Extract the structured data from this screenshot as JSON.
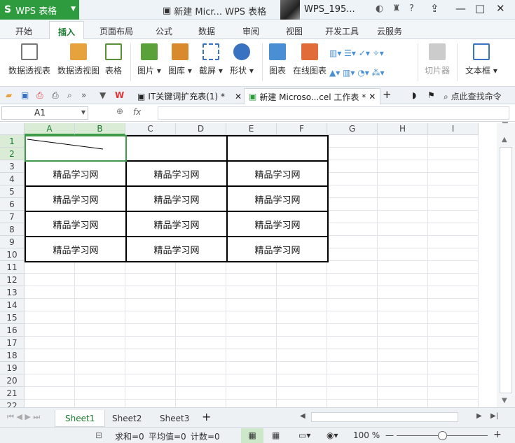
{
  "app": {
    "name": "WPS 表格",
    "logo": "S"
  },
  "title": {
    "doc": "新建 Micr... WPS 表格",
    "user": "WPS_195..."
  },
  "menu": [
    "开始",
    "插入",
    "页面布局",
    "公式",
    "数据",
    "审阅",
    "视图",
    "开发工具",
    "云服务"
  ],
  "ribbon": [
    "数据透视表",
    "数据透视图",
    "表格",
    "图片",
    "图库",
    "截屏",
    "形状",
    "图表",
    "在线图表",
    "切片器",
    "文本框"
  ],
  "tabs": {
    "tab1": "IT关键词扩充表(1) *",
    "tab2": "新建 Microso...cel 工作表 *",
    "find": "点此查找命令"
  },
  "formula": {
    "cell": "A1",
    "fx": "fx"
  },
  "columns": [
    "A",
    "B",
    "C",
    "D",
    "E",
    "F",
    "G",
    "H",
    "I"
  ],
  "rows": [
    "1",
    "2",
    "3",
    "4",
    "5",
    "6",
    "7",
    "8",
    "9",
    "10",
    "11",
    "12",
    "13",
    "14",
    "15",
    "16",
    "17",
    "18",
    "19",
    "20",
    "21",
    "22"
  ],
  "cell_text": "精品学习网",
  "sheets": [
    "Sheet1",
    "Sheet2",
    "Sheet3"
  ],
  "status": {
    "sum": "求和=0",
    "avg": "平均值=0",
    "count": "计数=0",
    "zoom": "100 %"
  }
}
